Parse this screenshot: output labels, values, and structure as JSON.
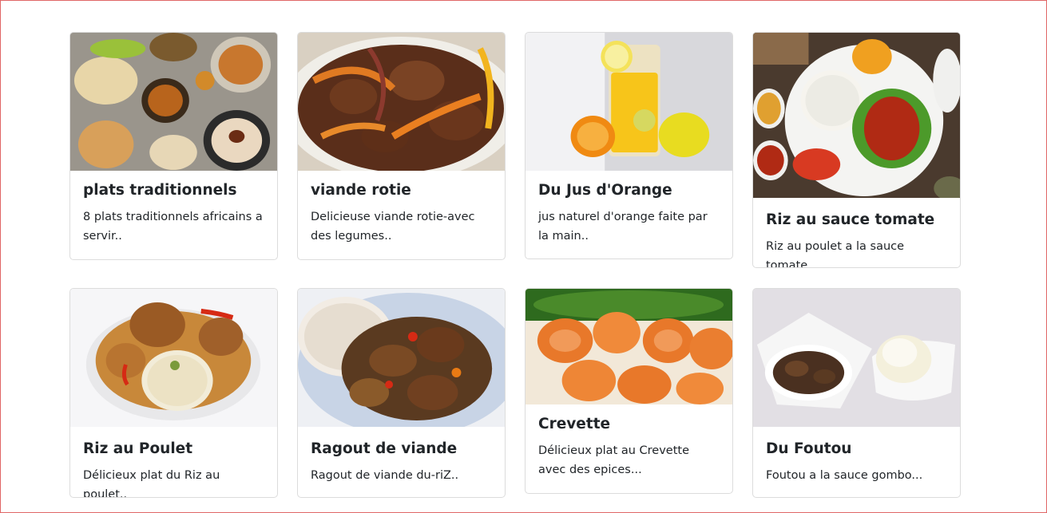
{
  "cards": [
    {
      "title": "plats traditionnels",
      "text": "8 plats traditionnels africains a servir..",
      "image": "traditional-dishes-photo"
    },
    {
      "title": "viande rotie",
      "text": "Delicieuse viande rotie-avec des legumes..",
      "image": "roasted-meat-photo"
    },
    {
      "title": "Du Jus d'Orange",
      "text": "jus naturel d'orange faite par la main..",
      "image": "orange-juice-photo"
    },
    {
      "title": "Riz au sauce tomate",
      "text": "Riz au poulet a la sauce tomate..",
      "image": "rice-tomato-sauce-photo"
    },
    {
      "title": "Riz au Poulet",
      "text": "Délicieux plat du Riz au poulet..",
      "image": "rice-chicken-photo"
    },
    {
      "title": "Ragout de viande",
      "text": "Ragout de viande du-riZ..",
      "image": "meat-stew-photo"
    },
    {
      "title": "Crevette",
      "text": "Délicieux plat au Crevette avec des epices...",
      "image": "shrimp-photo"
    },
    {
      "title": "Du Foutou",
      "text": "Foutou a la sauce gombo...",
      "image": "foutou-photo"
    }
  ]
}
